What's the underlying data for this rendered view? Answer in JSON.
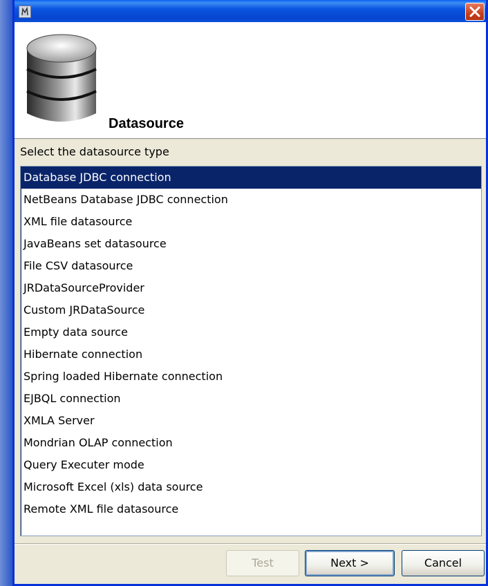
{
  "window": {
    "close_icon": "close-icon",
    "app_icon": "report-app-icon"
  },
  "header": {
    "title": "Datasource",
    "icon": "database-icon"
  },
  "prompt": "Select the datasource type",
  "list": {
    "selected_index": 0,
    "items": [
      "Database JDBC connection",
      "NetBeans Database JDBC connection",
      "XML file datasource",
      "JavaBeans set datasource",
      "File CSV datasource",
      "JRDataSourceProvider",
      "Custom JRDataSource",
      "Empty data source",
      "Hibernate connection",
      "Spring loaded Hibernate connection",
      "EJBQL connection",
      "XMLA Server",
      "Mondrian OLAP connection",
      "Query Executer mode",
      "Microsoft Excel (xls) data source",
      "Remote XML file datasource"
    ]
  },
  "buttons": {
    "test": "Test",
    "next": "Next >",
    "cancel": "Cancel"
  },
  "colors": {
    "selection": "#0a246a",
    "titlebar": "#0646d0",
    "close": "#c8401f"
  }
}
